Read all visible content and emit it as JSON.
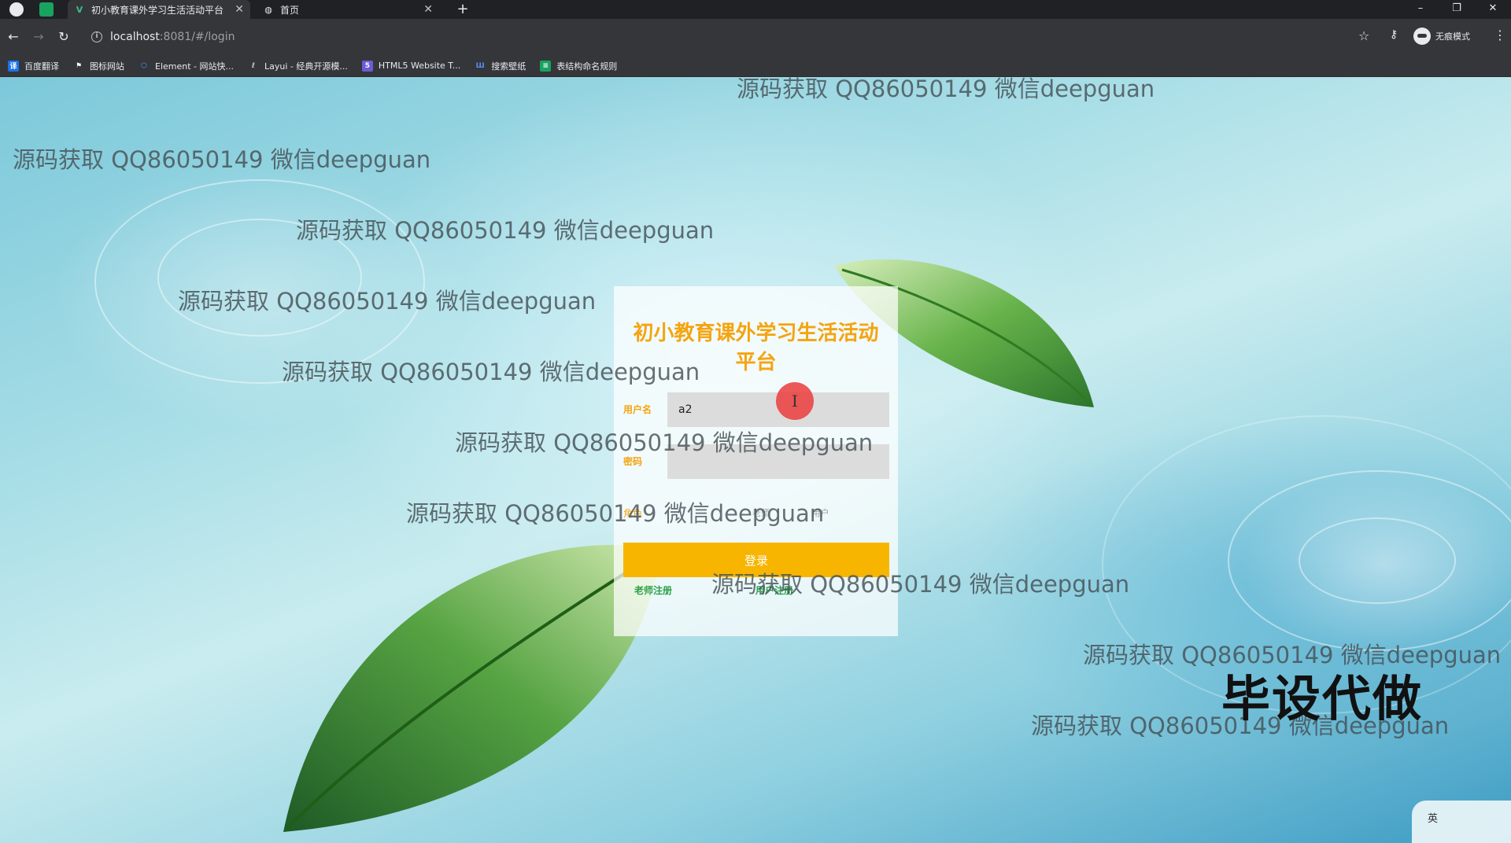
{
  "browser": {
    "tabs": [
      {
        "title": "初小教育课外学习生活活动平台",
        "active": true
      },
      {
        "title": "首页",
        "active": false
      }
    ],
    "url_host": "localhost",
    "url_path": ":8081/#/login",
    "profile_label": "无痕模式",
    "bookmarks": [
      {
        "label": "百度翻译",
        "icon": "translate-icon",
        "color": "#1a73e8"
      },
      {
        "label": "图标网站",
        "icon": "flag-icon",
        "color": "#ffffff"
      },
      {
        "label": "Element - 网站快...",
        "icon": "element-icon",
        "color": "#409eff"
      },
      {
        "label": "Layui - 经典开源模...",
        "icon": "layui-icon",
        "color": "#cccccc"
      },
      {
        "label": "HTML5 Website T...",
        "icon": "html5-icon",
        "color": "#6b5bd6"
      },
      {
        "label": "搜索壁纸",
        "icon": "wallpaper-icon",
        "color": "#3b6fd8"
      },
      {
        "label": "表结构命名规则",
        "icon": "doc-icon",
        "color": "#1aa260"
      }
    ]
  },
  "login": {
    "title": "初小教育课外学习生活活动平台",
    "username_label": "用户名",
    "username_value": "a2",
    "password_label": "密码",
    "role_label": "角色",
    "role_options": [
      "老师",
      "用户"
    ],
    "submit_label": "登录",
    "register_teacher": "老师注册",
    "register_user": "用户注册"
  },
  "watermark_text": "源码获取 QQ86050149 微信deepguan",
  "overlay_text": "毕设代做",
  "ime_label": "英",
  "colors": {
    "accent": "#f7b500",
    "title": "#f5a410",
    "link": "#2aa14a"
  }
}
